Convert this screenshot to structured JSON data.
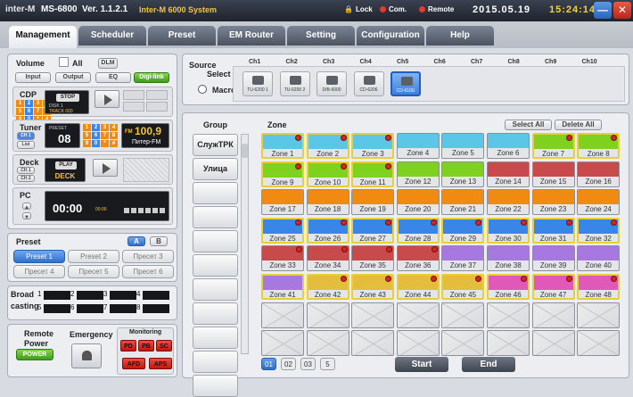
{
  "title": {
    "logo": "inter-M",
    "model": "MS-6800",
    "version": "Ver. 1.1.2.1",
    "system": "Inter-M 6000 System",
    "lock": "Lock",
    "com": "Com.",
    "remote": "Remote",
    "date": "2015.05.19",
    "time": "15:24:14"
  },
  "colors": {
    "accent": "#2f6fcf",
    "selected_border": "#e7cf3a",
    "zone_cyan": "#5bc6e5",
    "zone_green": "#7fd11f",
    "zone_orange": "#f08a10",
    "zone_blue": "#3a86e8",
    "zone_red": "#c94a4a",
    "zone_purple": "#a678e0",
    "zone_gold": "#e4bd3c",
    "zone_pink": "#e058b8"
  },
  "tabs": [
    "Management",
    "Scheduler",
    "Preset",
    "EM Router",
    "Setting",
    "Configuration",
    "Help"
  ],
  "volume": {
    "label": "Volume",
    "all": "All",
    "dlm": "DLM",
    "input": "Input",
    "output": "Output",
    "eq": "EQ",
    "digilink": "Digi-link"
  },
  "cdp": {
    "label": "CDP",
    "stop": "STOP",
    "disk": "DISK 1",
    "track": "TRACK 000"
  },
  "tuner": {
    "label": "Tuner",
    "ch1": "CH 1",
    "list": "List",
    "preset": "PRESET",
    "preset_num": "08",
    "band": "FM",
    "freq": "100,9",
    "station": "Питер-FM"
  },
  "deck": {
    "label": "Deck",
    "ch1": "CH 1",
    "ch2": "CH 2",
    "play": "PLAY",
    "name": "DECK"
  },
  "pc": {
    "label": "PC",
    "time": "00:00",
    "small": "00:00"
  },
  "keypad": [
    "1",
    "2",
    "3",
    "4",
    "5",
    "6",
    "7",
    "8",
    "9",
    "0",
    "*",
    "#"
  ],
  "preset": {
    "label": "Preset",
    "a": "A",
    "b": "B",
    "items": [
      "Preset 1",
      "Preset 2",
      "Пресет 3",
      "Пресет 4",
      "Пресет 5",
      "Пресет 6"
    ]
  },
  "broad": {
    "label1": "Broad",
    "label2": "casting",
    "nums": [
      "1",
      "2",
      "3",
      "4",
      "5",
      "6",
      "7",
      "8"
    ]
  },
  "bottom": {
    "remote1": "Remote",
    "remote2": "Power",
    "power": "POWER",
    "emergency": "Emergency",
    "monitoring": "Monitoring",
    "mon": [
      "PD",
      "PB",
      "SC",
      "AFD",
      "APS"
    ]
  },
  "source": {
    "label1": "Source",
    "label2": "Select",
    "macro": "Macro",
    "channels": [
      "Ch1",
      "Ch2",
      "Ch3",
      "Ch4",
      "Ch5",
      "Ch6",
      "Ch7",
      "Ch8",
      "Ch9",
      "Ch10"
    ],
    "devices": [
      "TU-6200 1",
      "TU-6200 2",
      "D/B-6000",
      "CD-6206",
      "CD-610U"
    ]
  },
  "group": {
    "label": "Group",
    "items": [
      "СлужТРК",
      "Улица",
      "",
      "",
      "",
      "",
      "",
      "",
      "",
      "",
      ""
    ]
  },
  "zone": {
    "label": "Zone",
    "select_all": "Select All",
    "delete_all": "Delete All",
    "names": [
      "Zone 1",
      "Zone 2",
      "Zone 3",
      "Zone 4",
      "Zone 5",
      "Zone 6",
      "Zone 7",
      "Zone 8",
      "Zone 9",
      "Zone 10",
      "Zone 11",
      "Zone 12",
      "Zone 13",
      "Zone 14",
      "Zone 15",
      "Zone 16",
      "Zone 17",
      "Zone 18",
      "Zone 19",
      "Zone 20",
      "Zone 21",
      "Zone 22",
      "Zone 23",
      "Zone 24",
      "Zone 25",
      "Zone 26",
      "Zone 27",
      "Zone 28",
      "Zone 29",
      "Zone 30",
      "Zone 31",
      "Zone 32",
      "Zone 33",
      "Zone 34",
      "Zone 35",
      "Zone 36",
      "Zone 37",
      "Zone 38",
      "Zone 39",
      "Zone 40",
      "Zone 41",
      "Zone 42",
      "Zone 43",
      "Zone 44",
      "Zone 45",
      "Zone 46",
      "Zone 47",
      "Zone 48"
    ],
    "selected": [
      1,
      2,
      3,
      7,
      8,
      9,
      10,
      11,
      25,
      26,
      27,
      28,
      29,
      30,
      31,
      32,
      41,
      42,
      43,
      44,
      45,
      46,
      47,
      48
    ],
    "marked": [
      1,
      2,
      3,
      7,
      8,
      9,
      10,
      11,
      25,
      26,
      27,
      28,
      29,
      30,
      31,
      32,
      33,
      34,
      35,
      36,
      42,
      43,
      44,
      45,
      46,
      47,
      48
    ]
  },
  "pages": [
    "01",
    "02",
    "03",
    "5"
  ],
  "start": "Start",
  "end": "End"
}
